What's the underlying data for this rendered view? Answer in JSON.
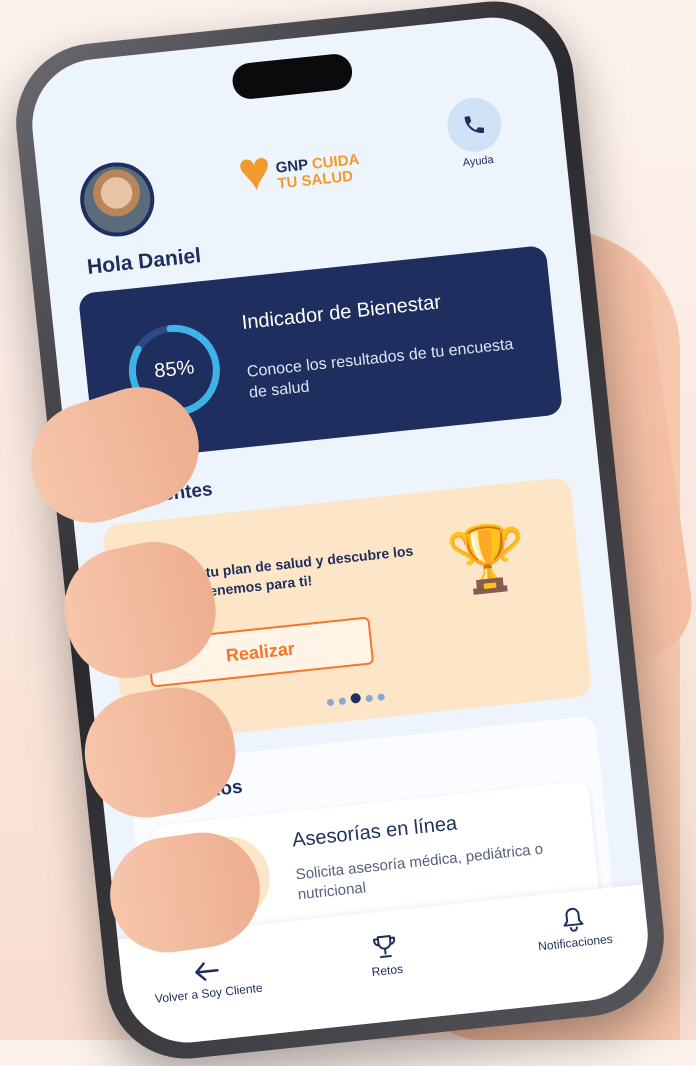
{
  "header": {
    "logo_line1": "GNP CUIDA",
    "logo_brand": "GNP",
    "logo_line1_rest": "CUIDA",
    "logo_line2": "TU SALUD",
    "help_label": "Ayuda"
  },
  "greeting": "Hola Daniel",
  "wellness": {
    "title": "Indicador de Bienestar",
    "percent_text": "85%",
    "percent_value": 85,
    "subtitle": "Conoce los resultados de tu encuesta de salud"
  },
  "pending": {
    "section_title": "Pendientes",
    "card_text": "¡Accede a tu plan de salud y descubre los retos que tenemos para ti!",
    "button_label": "Realizar",
    "dots_total": 5,
    "dots_active_index": 2
  },
  "benefits": {
    "section_title": "Beneficios",
    "item_title": "Asesorías en línea",
    "item_desc": "Solicita asesoría médica, pediátrica o nutricional"
  },
  "tabbar": {
    "back_label": "Volver a Soy Cliente",
    "retos_label": "Retos",
    "notif_label": "Notificaciones"
  },
  "colors": {
    "primary_navy": "#1e2e5e",
    "accent_orange": "#f2762e",
    "card_peach": "#fde6c7",
    "ring_cyan": "#3fb3e8"
  },
  "icons": [
    "phone-icon",
    "trophy-icon",
    "video-call-icon",
    "arrow-left-icon",
    "trophy-outline-icon",
    "bell-icon"
  ]
}
